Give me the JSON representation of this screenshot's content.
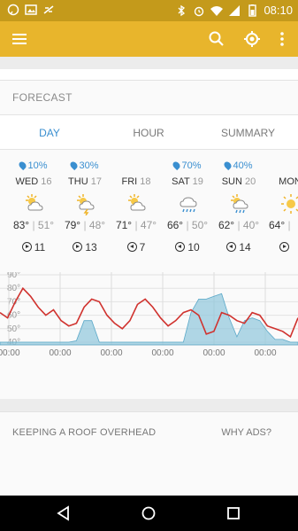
{
  "status": {
    "time": "08:10"
  },
  "forecast": {
    "title": "FORECAST",
    "tabs": [
      "DAY",
      "HOUR",
      "SUMMARY"
    ],
    "days": [
      {
        "precip": "",
        "name": "",
        "date": "",
        "hi": "",
        "lo": "°",
        "wind": "",
        "icon": "none",
        "wind_dir": "right"
      },
      {
        "precip": "10%",
        "name": "WED",
        "date": "16",
        "hi": "83°",
        "lo": "51°",
        "wind": "11",
        "icon": "partly-cloudy-icon",
        "wind_dir": "right"
      },
      {
        "precip": "30%",
        "name": "THU",
        "date": "17",
        "hi": "79°",
        "lo": "48°",
        "wind": "13",
        "icon": "thunderstorm-icon",
        "wind_dir": "right"
      },
      {
        "precip": "",
        "name": "FRI",
        "date": "18",
        "hi": "71°",
        "lo": "47°",
        "wind": "7",
        "icon": "partly-cloudy-icon",
        "wind_dir": "left"
      },
      {
        "precip": "70%",
        "name": "SAT",
        "date": "19",
        "hi": "66°",
        "lo": "50°",
        "wind": "10",
        "icon": "rain-icon",
        "wind_dir": "left"
      },
      {
        "precip": "40%",
        "name": "SUN",
        "date": "20",
        "hi": "62°",
        "lo": "40°",
        "wind": "14",
        "icon": "sun-rain-icon",
        "wind_dir": "left"
      },
      {
        "precip": "",
        "name": "MON",
        "date": "",
        "hi": "64°",
        "lo": "",
        "wind": "",
        "icon": "sunny-icon",
        "wind_dir": "right"
      }
    ]
  },
  "chart_data": {
    "type": "line",
    "y_tick_labels": [
      "90°",
      "80°",
      "70°",
      "60°",
      "50°",
      "40°"
    ],
    "x_tick_labels": [
      "00:00",
      "00:00",
      "00:00",
      "00:00",
      "00:00",
      "00:00"
    ],
    "series": [
      {
        "kind": "temperature",
        "color": "#d0322e",
        "values": [
          62,
          58,
          70,
          80,
          74,
          66,
          60,
          64,
          56,
          52,
          54,
          66,
          72,
          70,
          60,
          54,
          50,
          56,
          68,
          72,
          66,
          58,
          52,
          56,
          62,
          64,
          60,
          46,
          48,
          62,
          60,
          56,
          54,
          62,
          60,
          52,
          50,
          48,
          44,
          58
        ]
      },
      {
        "kind": "precipitation",
        "color": "#8fc6dc",
        "values": [
          40,
          40,
          40,
          40,
          40,
          40,
          40,
          40,
          40,
          40,
          41,
          56,
          56,
          40,
          40,
          40,
          40,
          40,
          40,
          40,
          40,
          40,
          40,
          40,
          40,
          62,
          72,
          72,
          74,
          76,
          58,
          44,
          56,
          58,
          56,
          48,
          42,
          42,
          40,
          40
        ]
      }
    ],
    "ylim": [
      38,
      92
    ],
    "grid": true
  },
  "ad": {
    "heading": "KEEPING A ROOF OVERHEAD",
    "why": "WHY ADS?"
  }
}
